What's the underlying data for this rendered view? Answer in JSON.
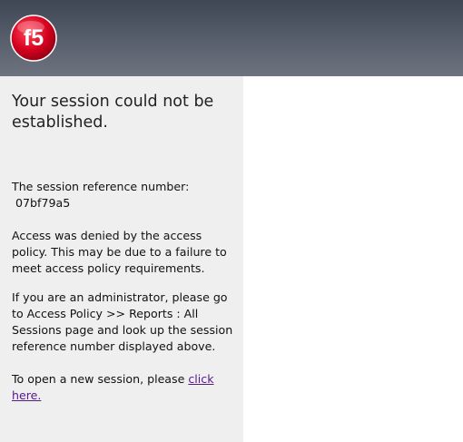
{
  "header": {
    "logo_text": "f5"
  },
  "colors": {
    "header_gradient_top": "#3f4654",
    "header_gradient_bottom": "#6d737f",
    "logo_red": "#d5001f",
    "panel_bg": "#efefef",
    "link": "#551a8b"
  },
  "main": {
    "title": "Your session could not be established.",
    "reference_label": "The session reference number:",
    "reference_number": "07bf79a5",
    "denied_message": "Access was denied by the access policy. This may be due to a failure to meet access policy requirements.",
    "admin_message": "If you are an administrator, please go to Access Policy >> Reports : All Sessions page and look up the session reference number displayed above.",
    "new_session_prefix": "To open a new session, please",
    "new_session_link": "click here."
  }
}
